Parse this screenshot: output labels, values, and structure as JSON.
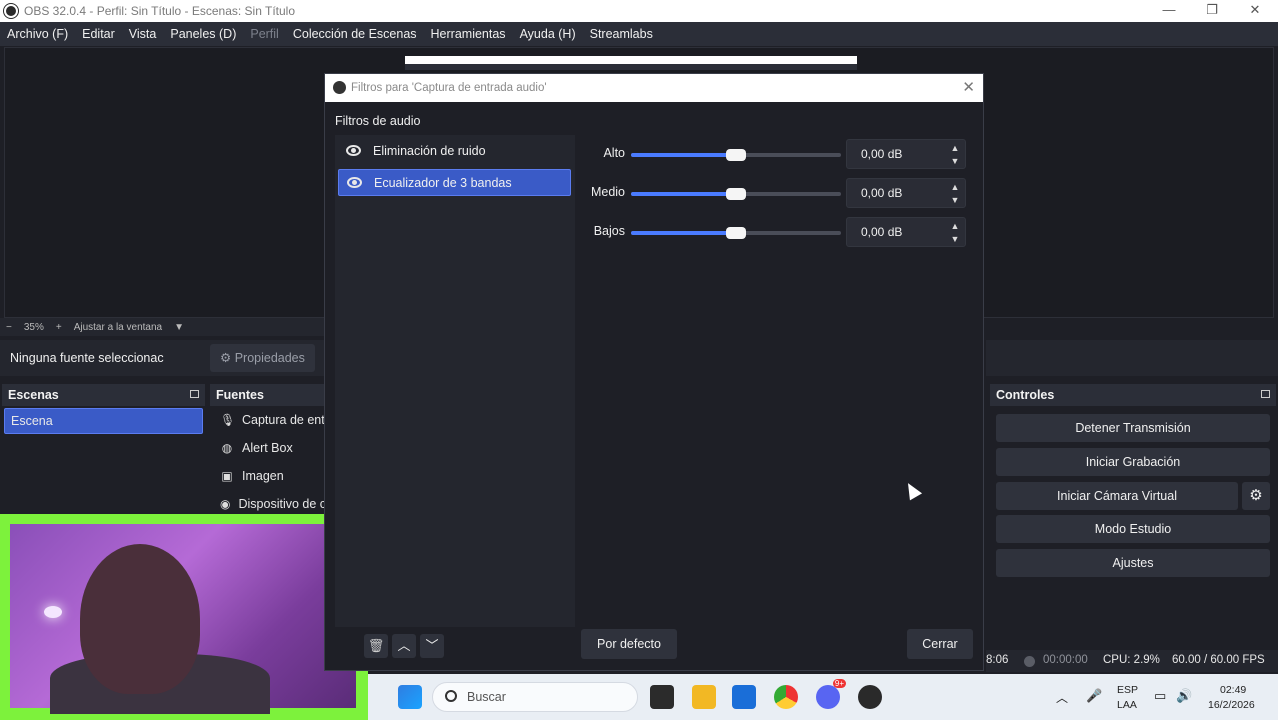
{
  "window": {
    "title": "OBS 32.0.4 - Perfil: Sin Título - Escenas: Sin Título"
  },
  "menu": [
    "Archivo (F)",
    "Editar",
    "Vista",
    "Paneles (D)",
    "Perfil",
    "Colección de Escenas",
    "Herramientas",
    "Ayuda (H)",
    "Streamlabs"
  ],
  "zoom": {
    "minus": "−",
    "level": "35%",
    "plus": "+",
    "fit": "Ajustar a la ventana"
  },
  "properties_row": {
    "no_source": "Ninguna fuente seleccionac",
    "properties": "Propiedades"
  },
  "scenes": {
    "title": "Escenas",
    "items": [
      "Escena"
    ]
  },
  "sources": {
    "title": "Fuentes",
    "items": [
      "Captura de ent",
      "Alert Box",
      "Imagen",
      "Dispositivo de c"
    ]
  },
  "controls": {
    "title": "Controles",
    "stop_stream": "Detener Transmisión",
    "start_recording": "Iniciar Grabación",
    "virtual_cam": "Iniciar Cámara Virtual",
    "studio_mode": "Modo Estudio",
    "settings": "Ajustes"
  },
  "dialog": {
    "title": "Filtros para 'Captura de entrada audio'",
    "section": "Filtros de audio",
    "filters": [
      "Eliminación de ruido",
      "Ecualizador de 3 bandas"
    ],
    "bands": [
      {
        "label": "Alto",
        "value": "0,00 dB",
        "level": 0.5
      },
      {
        "label": "Medio",
        "value": "0,00 dB",
        "level": 0.5
      },
      {
        "label": "Bajos",
        "value": "0,00 dB",
        "level": 0.5
      }
    ],
    "defaults_button": "Por defecto",
    "close_button": "Cerrar"
  },
  "status": {
    "time": "8:06",
    "rec_time": "00:00:00",
    "cpu": "CPU: 2.9%",
    "fps": "60.00 / 60.00 FPS"
  },
  "taskbar": {
    "search": "Buscar",
    "lang": "ESP",
    "lang2": "LAA",
    "clock": "02:49",
    "date": "16/2/2026",
    "badge": "9+"
  },
  "colors": {
    "accent": "#3a5bc7",
    "webcam_frame": "#7df23c"
  }
}
